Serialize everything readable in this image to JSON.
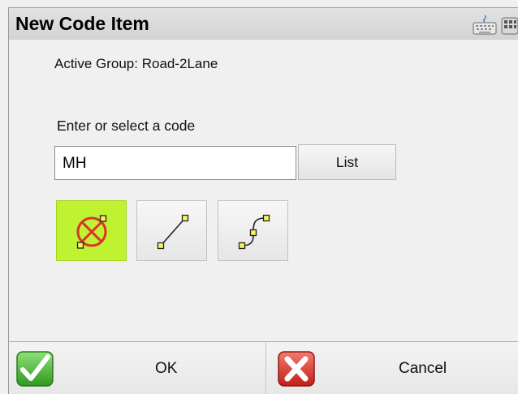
{
  "window": {
    "title": "New Code Item",
    "icons": [
      "keyboard-icon",
      "keypad-grid-icon"
    ]
  },
  "content": {
    "active_group": "Active Group: Road-2Lane",
    "prompt": "Enter or select a code",
    "code_input": {
      "value": "MH",
      "placeholder": ""
    },
    "list_button_label": "List",
    "feature_types": [
      {
        "name": "point",
        "icon": "point-feature-icon",
        "selected": true
      },
      {
        "name": "line",
        "icon": "line-feature-icon",
        "selected": false
      },
      {
        "name": "curve",
        "icon": "curve-feature-icon",
        "selected": false
      }
    ]
  },
  "footer": {
    "ok_label": "OK",
    "cancel_label": "Cancel",
    "ok_icon": "green-checkmark-icon",
    "cancel_icon": "red-x-icon"
  },
  "colors": {
    "selected_accent": "#bff230",
    "vertex_fill": "#f7f35a",
    "ok_green": "#3fae2a",
    "cancel_red": "#d93028"
  }
}
